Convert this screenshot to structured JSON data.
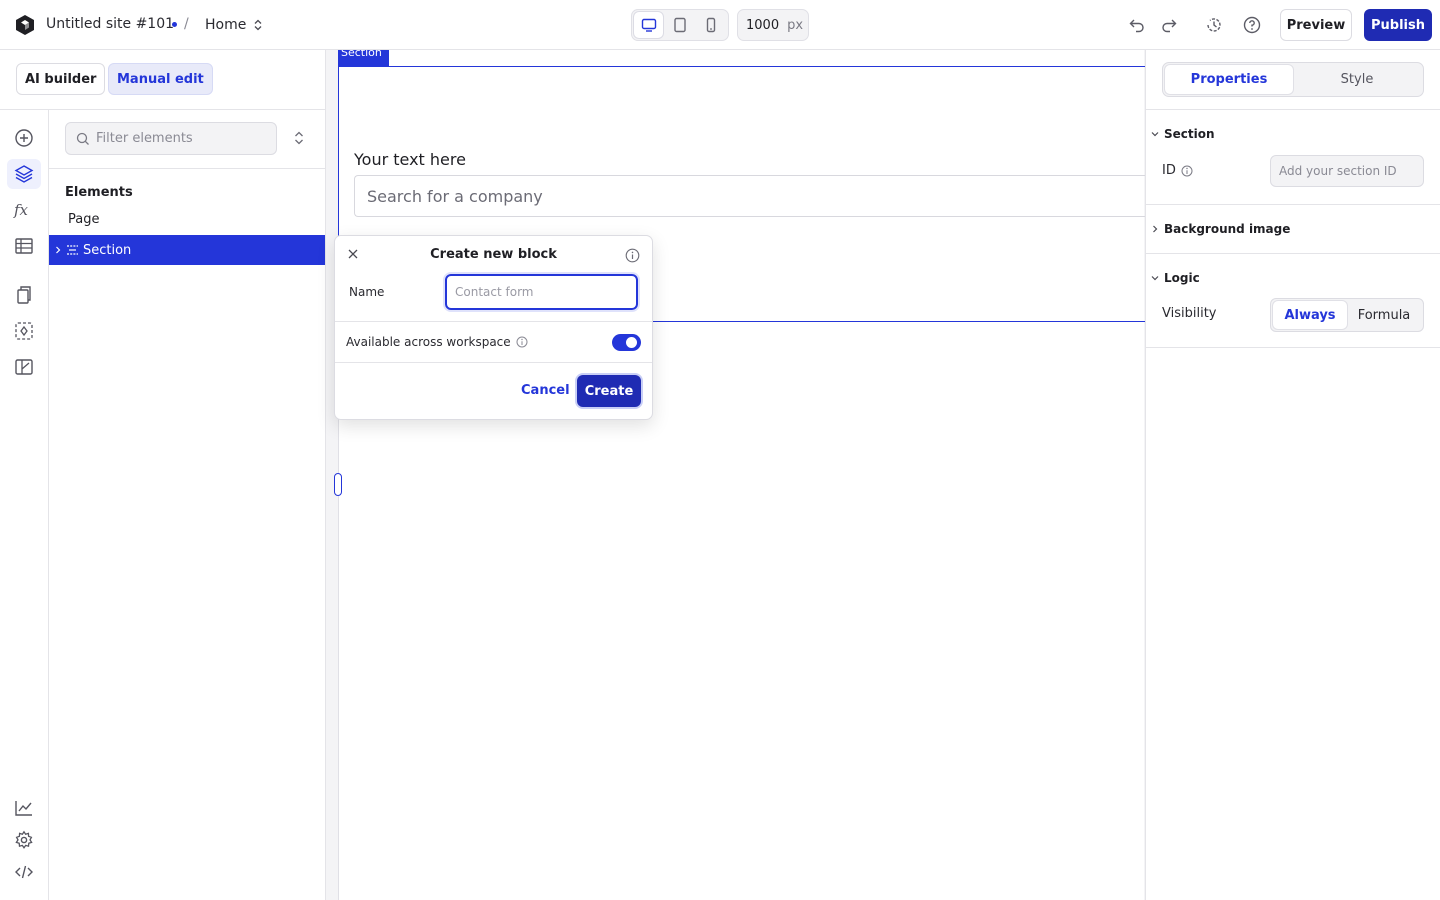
{
  "topbar": {
    "site_name": "Untitled site #101",
    "separator": "/",
    "page_name": "Home",
    "width_value": "1000",
    "width_unit": "px",
    "preview_label": "Preview",
    "publish_label": "Publish"
  },
  "modes": {
    "ai_label": "AI builder",
    "manual_label": "Manual edit"
  },
  "left_panel": {
    "filter_placeholder": "Filter elements",
    "elements_title": "Elements",
    "tree": [
      {
        "label": "Page"
      },
      {
        "label": "Section",
        "selected": true
      }
    ]
  },
  "canvas": {
    "section_tag": "Section",
    "text": "Your text here",
    "input_placeholder": "Search for a company"
  },
  "modal": {
    "title": "Create new block",
    "name_label": "Name",
    "name_placeholder": "Contact form",
    "available_label": "Available across workspace",
    "available_on": true,
    "cancel_label": "Cancel",
    "create_label": "Create"
  },
  "right_panel": {
    "tabs": [
      {
        "label": "Properties",
        "active": true
      },
      {
        "label": "Style",
        "active": false
      }
    ],
    "section_heading": "Section",
    "id_label": "ID",
    "id_placeholder": "Add your section ID",
    "background_heading": "Background image",
    "logic_heading": "Logic",
    "visibility_label": "Visibility",
    "visibility_options": [
      {
        "label": "Always",
        "active": true
      },
      {
        "label": "Formula",
        "active": false
      }
    ]
  },
  "colors": {
    "accent": "#2436d9",
    "primary_button": "#1f2bb3",
    "border": "#e4e4e8"
  }
}
